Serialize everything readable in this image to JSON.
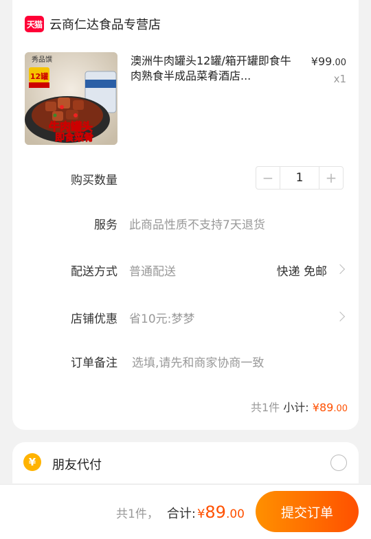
{
  "shop": {
    "badge": "天猫",
    "name": "云商仁达食品专营店"
  },
  "product": {
    "image_alt": "牛肉罐头即食菜肴",
    "title": "澳洲牛肉罐头12罐/箱开罐即食牛肉熟食半成品菜肴酒店...",
    "price_symbol": "¥",
    "price_int": "99",
    "price_dec": ".00",
    "quantity_text": "x1",
    "image_texts": {
      "brand": "秀品馔",
      "badge": "12罐",
      "line1": "牛肉罐头",
      "line2": "即食菜肴"
    }
  },
  "rows": {
    "quantity": {
      "label": "购买数量",
      "value": "1",
      "minus": "−",
      "plus": "+"
    },
    "service": {
      "label": "服务",
      "value": "此商品性质不支持7天退货"
    },
    "delivery": {
      "label": "配送方式",
      "value": "普通配送",
      "right": "快递 免邮"
    },
    "coupon": {
      "label": "店铺优惠",
      "value": "省10元:梦梦"
    },
    "note": {
      "label": "订单备注",
      "placeholder": "选填,请先和商家协商一致"
    }
  },
  "subtotal": {
    "count": "共1件",
    "label": "小计:",
    "symbol": "¥",
    "int": "89",
    "dec": ".00"
  },
  "friend_pay": {
    "icon": "¥",
    "label": "朋友代付"
  },
  "bottom": {
    "count": "共1件，",
    "label": "合计:",
    "symbol": "¥",
    "int": "89",
    "dec": ".00",
    "submit": "提交订单"
  },
  "colors": {
    "accent": "#ff5000",
    "tmall_red": "#ff0036",
    "coin_yellow": "#ffb300"
  }
}
